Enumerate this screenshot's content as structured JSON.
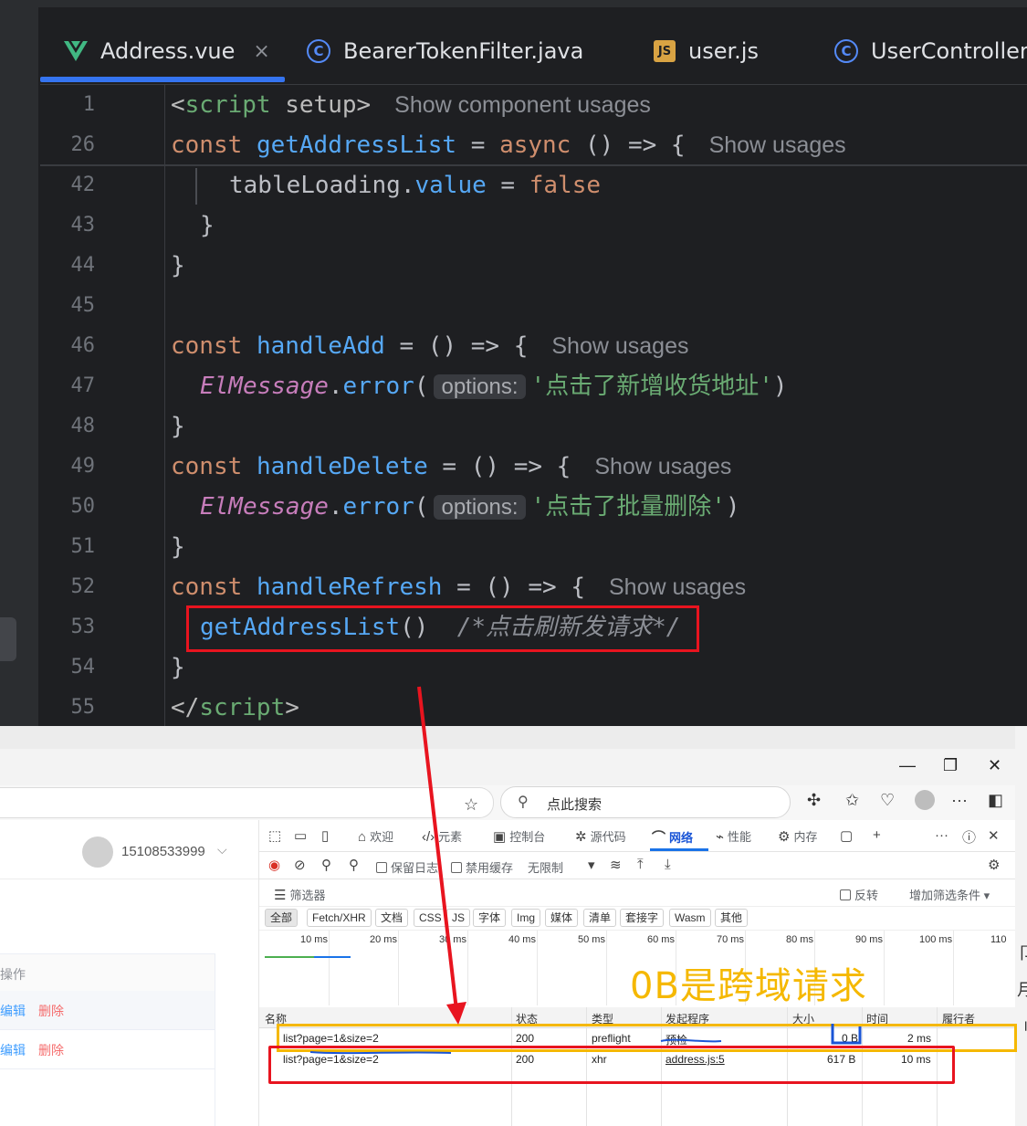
{
  "ide": {
    "tabs": [
      {
        "label": "Address.vue",
        "icon": "vue-icon"
      },
      {
        "label": "BearerTokenFilter.java",
        "icon": "class-icon"
      },
      {
        "label": "user.js",
        "icon": "js-icon"
      },
      {
        "label": "UserController",
        "icon": "class-icon"
      }
    ],
    "close_glyph": "×",
    "line_numbers": [
      "1",
      "26",
      "42",
      "43",
      "44",
      "45",
      "46",
      "47",
      "48",
      "49",
      "50",
      "51",
      "52",
      "53",
      "54",
      "55"
    ],
    "code": {
      "l1_open": "<",
      "l1_tag": "script",
      "l1_attr": " setup",
      "l1_close": ">",
      "l1_hint": "Show component usages",
      "l26_kw": "const",
      "l26_fn": "getAddressList",
      "l26_mid": " = ",
      "l26_async": "async",
      "l26_rest": " () => {",
      "l26_hint": "Show usages",
      "l42_obj": "tableLoading",
      "l42_dot": ".",
      "l42_prop": "value",
      "l42_eq": " = ",
      "l42_val": "false",
      "l43": "}",
      "l44": "}",
      "l46_kw": "const",
      "l46_fn": "handleAdd",
      "l46_rest": " = () => {",
      "l46_hint": "Show usages",
      "l47_cls": "ElMessage",
      "l47_dot": ".",
      "l47_method": "error",
      "l47_open": "(",
      "l47_param": "options:",
      "l47_str": "'点击了新增收货地址'",
      "l47_close": ")",
      "l48": "}",
      "l49_kw": "const",
      "l49_fn": "handleDelete",
      "l49_rest": " = () => {",
      "l49_hint": "Show usages",
      "l50_cls": "ElMessage",
      "l50_dot": ".",
      "l50_method": "error",
      "l50_open": "(",
      "l50_param": "options:",
      "l50_str": "'点击了批量删除'",
      "l50_close": ")",
      "l51": "}",
      "l52_kw": "const",
      "l52_fn": "handleRefresh",
      "l52_rest": " = () => {",
      "l52_hint": "Show usages",
      "l53_call": "getAddressList",
      "l53_paren": "()",
      "l53_cmt": "/*点击刷新发请求*/",
      "l54": "}",
      "l55_open": "</",
      "l55_tag": "script",
      "l55_close": ">"
    }
  },
  "browser": {
    "window_controls": [
      "—",
      "❐",
      "✕"
    ],
    "search_placeholder": "点此搜索",
    "user_phone": "15108533999",
    "ops_header": "操作",
    "rows": [
      {
        "edit": "编辑",
        "delete": "删除"
      },
      {
        "edit": "编辑",
        "delete": "删除"
      }
    ]
  },
  "devtools": {
    "tabs": [
      "欢迎",
      "元素",
      "控制台",
      "源代码",
      "网络",
      "性能",
      "内存"
    ],
    "toolbar": {
      "preserve_log": "保留日志",
      "disable_cache": "禁用缓存",
      "throttle": "无限制"
    },
    "filter_placeholder": "筛选器",
    "invert": "反转",
    "more_filters": "增加筛选条件",
    "type_filters": [
      "全部",
      "Fetch/XHR",
      "文档",
      "CSS",
      "JS",
      "字体",
      "Img",
      "媒体",
      "清单",
      "套接字",
      "Wasm",
      "其他"
    ],
    "timeline_ticks": [
      "10 ms",
      "20 ms",
      "30 ms",
      "40 ms",
      "50 ms",
      "60 ms",
      "70 ms",
      "80 ms",
      "90 ms",
      "100 ms",
      "110"
    ],
    "annotation": "0B是跨域请求",
    "columns": [
      "名称",
      "状态",
      "类型",
      "发起程序",
      "大小",
      "时间",
      "履行者"
    ],
    "requests": [
      {
        "name": "list?page=1&size=2",
        "status": "200",
        "type": "preflight",
        "initiator": "预检",
        "size": "0 B",
        "time": "2 ms"
      },
      {
        "name": "list?page=1&size=2",
        "status": "200",
        "type": "xhr",
        "initiator": "address.js:5",
        "size": "617 B",
        "time": "10 ms"
      }
    ]
  },
  "colors": {
    "highlight_red": "#e8141f",
    "highlight_yellow": "#f5b800",
    "accent_blue": "#3574f0"
  }
}
